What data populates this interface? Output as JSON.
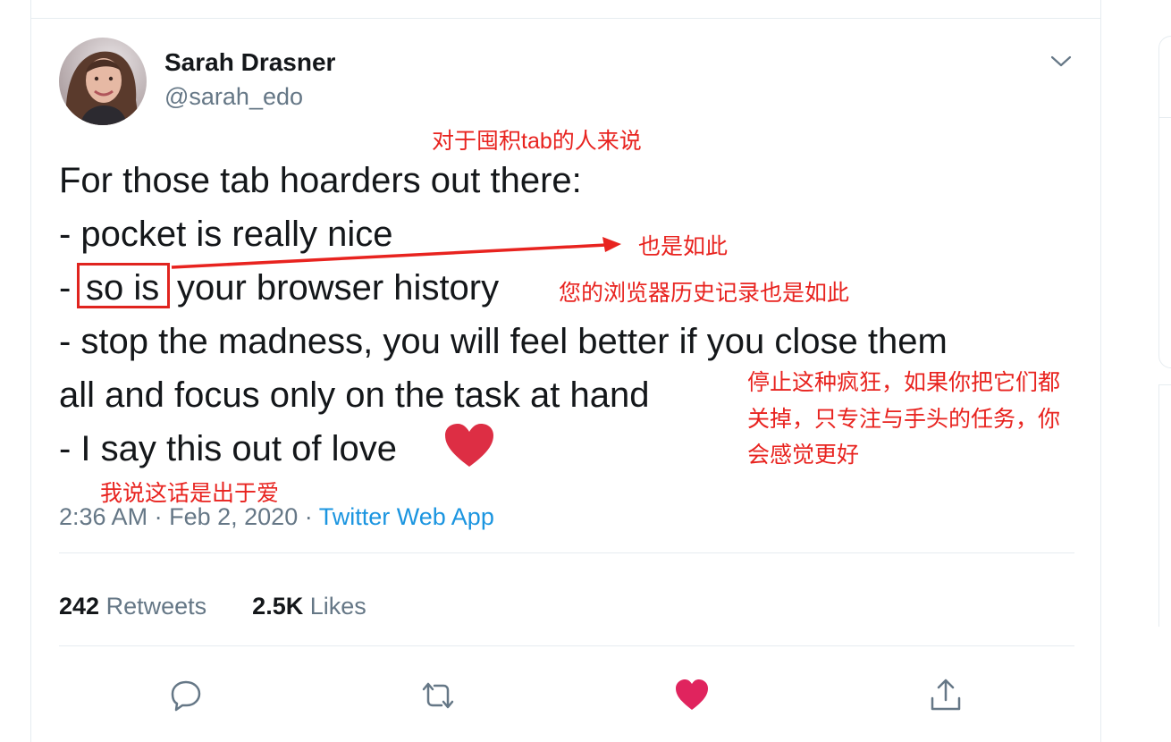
{
  "tweet": {
    "author": {
      "display_name": "Sarah Drasner",
      "handle": "@sarah_edo"
    },
    "lines": [
      "For those tab hoarders out there:",
      "- pocket is really nice",
      "-",
      "so is",
      "your browser history",
      "- stop the madness, you will feel better if you close them",
      "all and focus only on the task at hand",
      "- I say this out of love"
    ],
    "meta": {
      "time": "2:36 AM",
      "date": "Feb 2, 2020",
      "separator": "·",
      "source": "Twitter Web App"
    },
    "stats": {
      "retweets": {
        "count": "242",
        "label": "Retweets"
      },
      "likes": {
        "count": "2.5K",
        "label": "Likes"
      }
    }
  },
  "annotations": {
    "title_cn": "对于囤积tab的人来说",
    "arrow_cn": "也是如此",
    "browser_cn": "您的浏览器历史记录也是如此",
    "stop_cn_1": "停止这种疯狂，如果你把它们都",
    "stop_cn_2": "关掉，只专注与手头的任务，你",
    "stop_cn_3": "会感觉更好",
    "love_cn": "我说这话是出于爱",
    "color": "#e8231f"
  },
  "icons": {
    "reply": "reply-icon",
    "retweet": "retweet-icon",
    "like": "heart-icon",
    "share": "share-icon",
    "caret": "chevron-down-icon"
  },
  "colors": {
    "heart": "#e0245e",
    "link": "#1b95e0",
    "secondary_text": "#657786"
  }
}
